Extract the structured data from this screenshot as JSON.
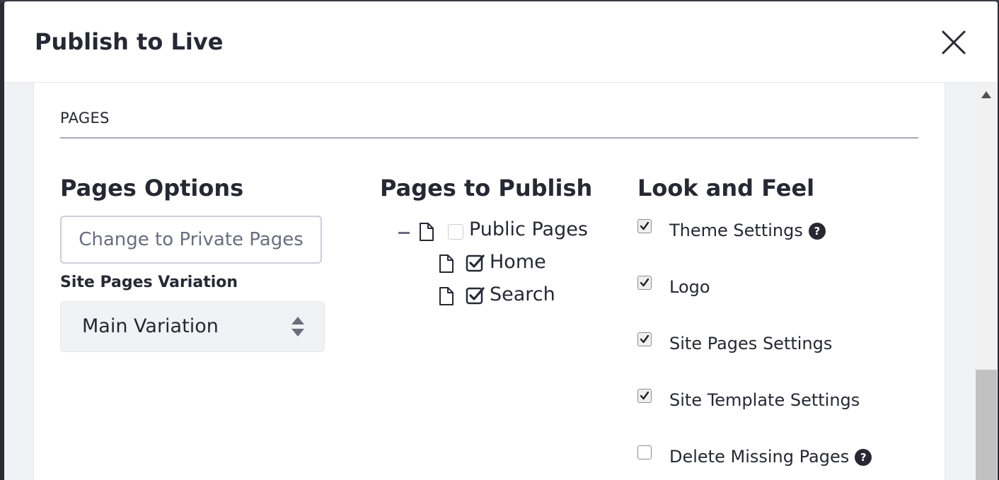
{
  "modal": {
    "title": "Publish to Live",
    "close_icon": "close-icon"
  },
  "section": {
    "title": "PAGES"
  },
  "pages_options": {
    "heading": "Pages Options",
    "change_button_label": "Change to Private Pages",
    "variation_label": "Site Pages Variation",
    "variation_value": "Main Variation"
  },
  "pages_to_publish": {
    "heading": "Pages to Publish",
    "tree": [
      {
        "label": "Public Pages",
        "checked": false,
        "icon": "page-icon",
        "collapse_icon": "minus-icon"
      },
      {
        "label": "Home",
        "checked": true,
        "icon": "page-icon"
      },
      {
        "label": "Search",
        "checked": true,
        "icon": "page-icon"
      }
    ]
  },
  "look_and_feel": {
    "heading": "Look and Feel",
    "items": [
      {
        "label": "Theme Settings",
        "checked": true,
        "help": true
      },
      {
        "label": "Logo",
        "checked": true,
        "help": false
      },
      {
        "label": "Site Pages Settings",
        "checked": true,
        "help": false
      },
      {
        "label": "Site Template Settings",
        "checked": true,
        "help": false
      },
      {
        "label": "Delete Missing Pages",
        "checked": false,
        "help": true
      }
    ],
    "help_glyph": "?"
  },
  "colors": {
    "text": "#272833",
    "muted": "#6b6c7e",
    "border": "#cdced9",
    "body_bg": "#f1f2f5"
  }
}
